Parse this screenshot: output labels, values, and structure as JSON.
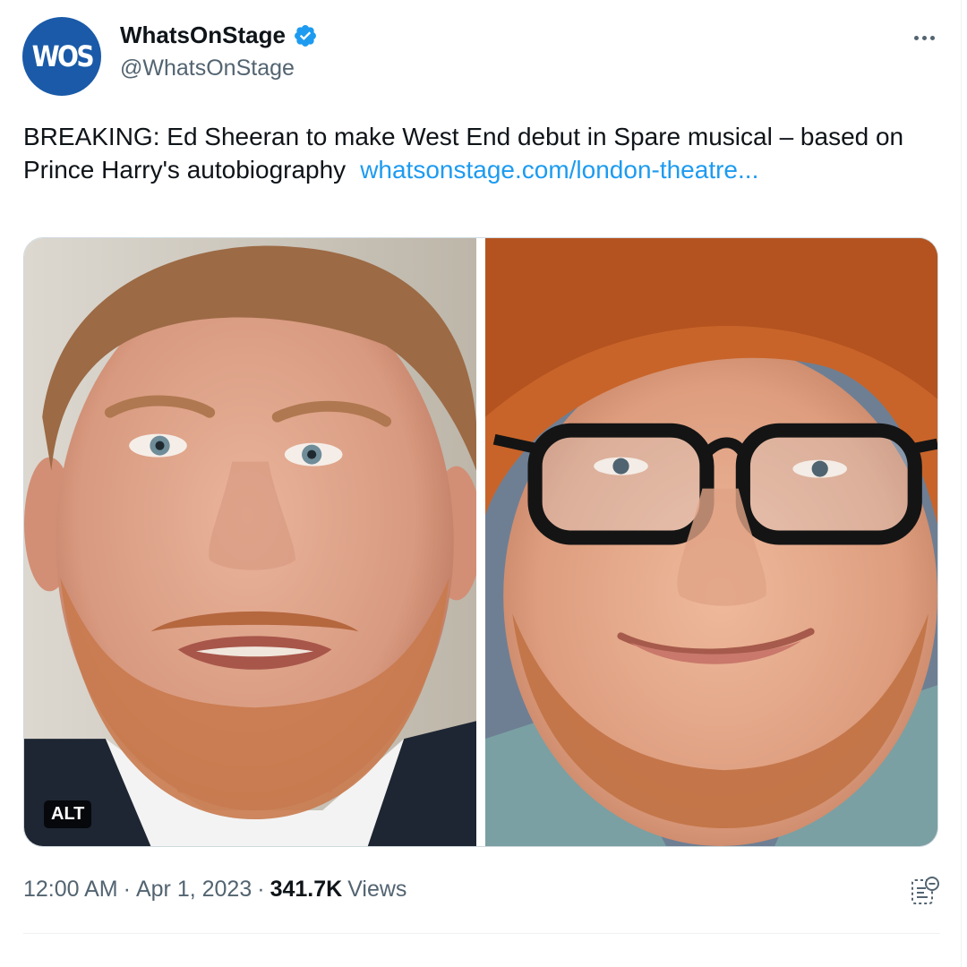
{
  "author": {
    "avatar_text": "WOS",
    "display_name": "WhatsOnStage",
    "handle": "@WhatsOnStage",
    "verified": true
  },
  "tweet": {
    "text": "BREAKING: Ed Sheeran to make West End debut in Spare musical – based on Prince Harry's autobiography",
    "link": "whatsonstage.com/london-theatre..."
  },
  "media": {
    "alt_badge": "ALT"
  },
  "meta": {
    "time": "12:00 AM",
    "separator": "·",
    "date": "Apr 1, 2023",
    "views_count": "341.7K",
    "views_label": "Views"
  },
  "icons": {
    "verified": "verified-badge-icon",
    "more": "more-options-icon",
    "analytics": "analytics-icon"
  },
  "colors": {
    "brand_blue": "#1a5aa8",
    "link": "#1d9bf0",
    "secondary_text": "#536471",
    "primary_text": "#0f1419"
  }
}
